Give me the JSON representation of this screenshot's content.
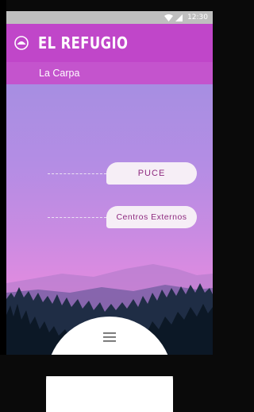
{
  "status_bar": {
    "time": "12:30",
    "icons": [
      "wifi-icon",
      "signal-icon"
    ]
  },
  "app_bar": {
    "title": "EL REFUGIO",
    "logo_icon": "logo-icon"
  },
  "subheader": {
    "label": "La Carpa"
  },
  "options": [
    {
      "label": "PUCE"
    },
    {
      "label": "Centros Externos"
    }
  ],
  "menu": {
    "icon": "menu-icon"
  },
  "colors": {
    "app_bar": "#c046c9",
    "subheader": "#c454cd",
    "pill_bg": "#f6eef6",
    "pill_text": "#8e2a7f"
  }
}
